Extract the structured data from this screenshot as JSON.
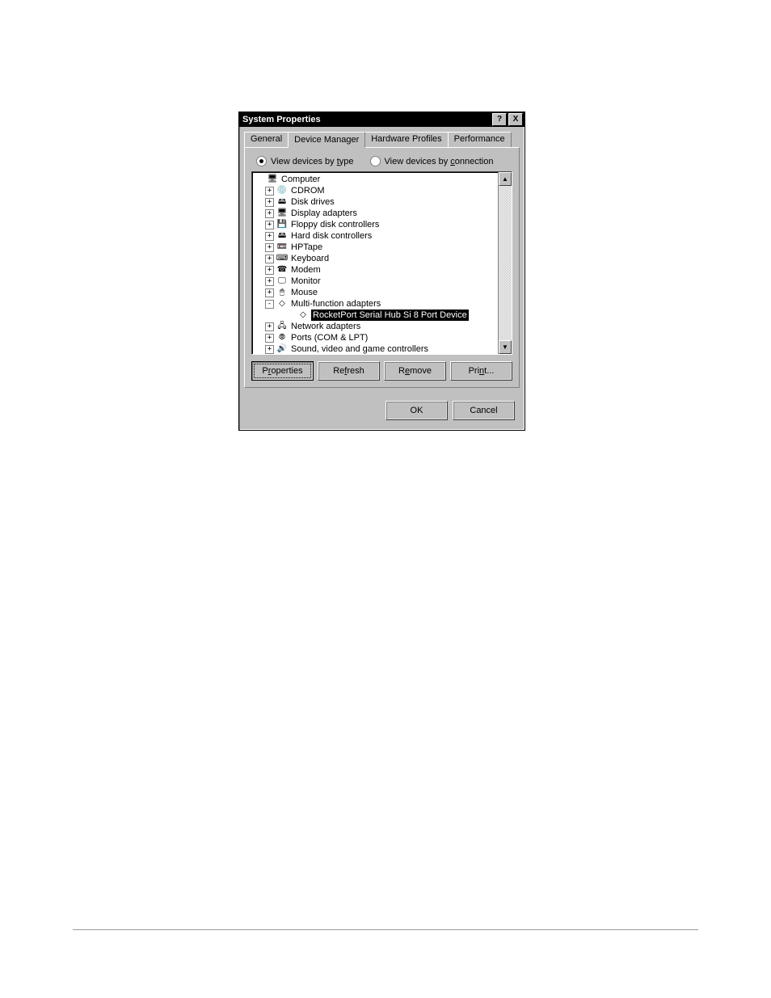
{
  "titlebar": {
    "title": "System Properties",
    "help_symbol": "?",
    "close_symbol": "X"
  },
  "tabs": {
    "general": "General",
    "device_manager": "Device Manager",
    "hardware_profiles": "Hardware Profiles",
    "performance": "Performance"
  },
  "radios": {
    "by_type_prefix": "View devices by ",
    "by_type_underline": "t",
    "by_type_suffix": "ype",
    "by_conn_prefix": "View devices by ",
    "by_conn_underline": "c",
    "by_conn_suffix": "onnection"
  },
  "tree": [
    {
      "indent": 0,
      "expand": "",
      "icon": "🖥",
      "label": "Computer",
      "selected": false
    },
    {
      "indent": 1,
      "expand": "+",
      "icon": "💿",
      "label": "CDROM",
      "selected": false
    },
    {
      "indent": 1,
      "expand": "+",
      "icon": "🖴",
      "label": "Disk drives",
      "selected": false
    },
    {
      "indent": 1,
      "expand": "+",
      "icon": "🖥",
      "label": "Display adapters",
      "selected": false
    },
    {
      "indent": 1,
      "expand": "+",
      "icon": "💾",
      "label": "Floppy disk controllers",
      "selected": false
    },
    {
      "indent": 1,
      "expand": "+",
      "icon": "🖴",
      "label": "Hard disk controllers",
      "selected": false
    },
    {
      "indent": 1,
      "expand": "+",
      "icon": "📼",
      "label": "HPTape",
      "selected": false
    },
    {
      "indent": 1,
      "expand": "+",
      "icon": "⌨",
      "label": "Keyboard",
      "selected": false
    },
    {
      "indent": 1,
      "expand": "+",
      "icon": "☎",
      "label": "Modem",
      "selected": false
    },
    {
      "indent": 1,
      "expand": "+",
      "icon": "🖵",
      "label": "Monitor",
      "selected": false
    },
    {
      "indent": 1,
      "expand": "+",
      "icon": "🖱",
      "label": "Mouse",
      "selected": false
    },
    {
      "indent": 1,
      "expand": "-",
      "icon": "◇",
      "label": "Multi-function adapters",
      "selected": false
    },
    {
      "indent": 3,
      "expand": "",
      "icon": "◇",
      "label": "RocketPort Serial Hub Si 8 Port Device",
      "selected": true
    },
    {
      "indent": 1,
      "expand": "+",
      "icon": "🖧",
      "label": "Network adapters",
      "selected": false
    },
    {
      "indent": 1,
      "expand": "+",
      "icon": "⦾",
      "label": "Ports (COM & LPT)",
      "selected": false
    },
    {
      "indent": 1,
      "expand": "+",
      "icon": "🔊",
      "label": "Sound, video and game controllers",
      "selected": false
    }
  ],
  "buttons": {
    "properties_prefix": "P",
    "properties_underline": "r",
    "properties_suffix": "operties",
    "refresh_prefix": "Re",
    "refresh_underline": "f",
    "refresh_suffix": "resh",
    "remove_prefix": "R",
    "remove_underline": "e",
    "remove_suffix": "move",
    "print_prefix": "Pri",
    "print_underline": "n",
    "print_suffix": "t..."
  },
  "footer": {
    "ok": "OK",
    "cancel": "Cancel"
  },
  "scroll": {
    "up": "▲",
    "down": "▼"
  }
}
